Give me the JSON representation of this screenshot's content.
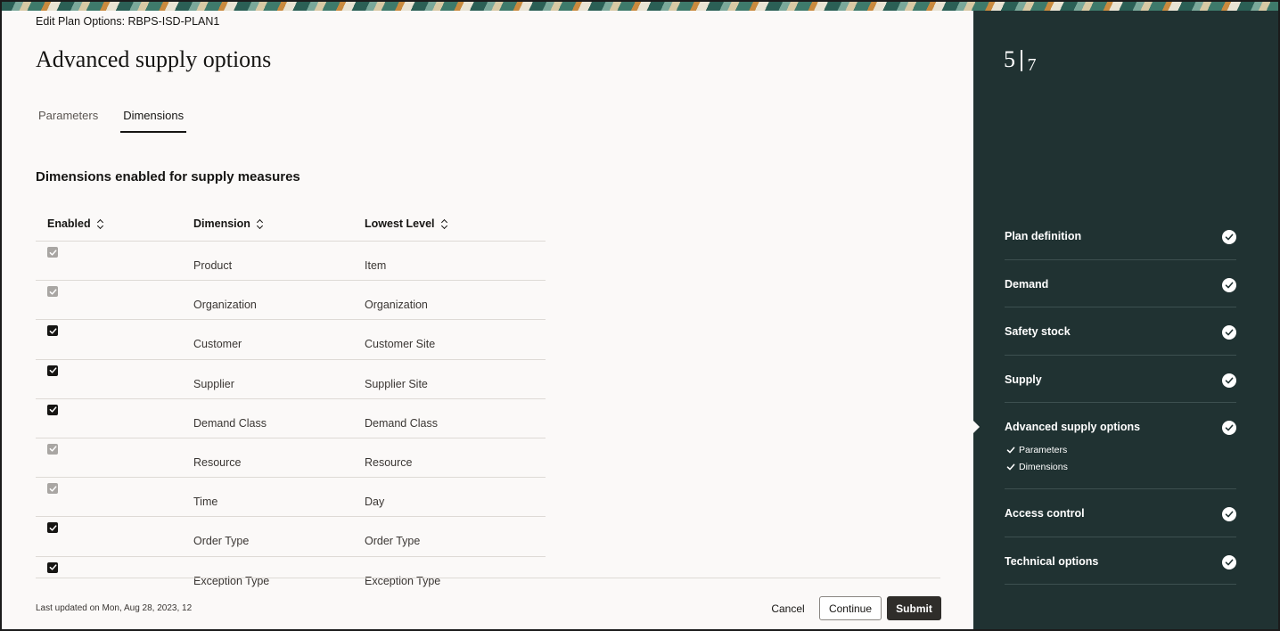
{
  "breadcrumb": "Edit Plan Options: RBPS-ISD-PLAN1",
  "page_title": "Advanced supply options",
  "tabs": [
    {
      "label": "Parameters",
      "active": false
    },
    {
      "label": "Dimensions",
      "active": true
    }
  ],
  "section_title": "Dimensions enabled for supply measures",
  "table": {
    "columns": [
      "Enabled",
      "Dimension",
      "Lowest Level"
    ],
    "rows": [
      {
        "enabled": "disabled",
        "dimension": "Product",
        "lowest_level": "Item"
      },
      {
        "enabled": "disabled",
        "dimension": "Organization",
        "lowest_level": "Organization"
      },
      {
        "enabled": "on",
        "dimension": "Customer",
        "lowest_level": "Customer Site"
      },
      {
        "enabled": "on",
        "dimension": "Supplier",
        "lowest_level": "Supplier Site"
      },
      {
        "enabled": "on",
        "dimension": "Demand Class",
        "lowest_level": "Demand Class"
      },
      {
        "enabled": "disabled",
        "dimension": "Resource",
        "lowest_level": "Resource"
      },
      {
        "enabled": "disabled",
        "dimension": "Time",
        "lowest_level": "Day"
      },
      {
        "enabled": "on",
        "dimension": "Order Type",
        "lowest_level": "Order Type"
      },
      {
        "enabled": "on",
        "dimension": "Exception Type",
        "lowest_level": "Exception Type"
      }
    ]
  },
  "footer": {
    "last_updated": "Last updated on Mon, Aug 28, 2023, 12",
    "cancel_label": "Cancel",
    "continue_label": "Continue",
    "submit_label": "Submit"
  },
  "side": {
    "step_current": "5",
    "step_total": "7",
    "nav": [
      {
        "label": "Plan definition",
        "complete": true
      },
      {
        "label": "Demand",
        "complete": true
      },
      {
        "label": "Safety stock",
        "complete": true
      },
      {
        "label": "Supply",
        "complete": true
      },
      {
        "label": "Advanced supply options",
        "complete": true,
        "current": true,
        "sub": [
          "Parameters",
          "Dimensions"
        ]
      },
      {
        "label": "Access control",
        "complete": true
      },
      {
        "label": "Technical options",
        "complete": true
      }
    ]
  },
  "colors": {
    "side_panel": "#203232",
    "submit_button": "#2f2d2a",
    "page_background": "#fbf9f8"
  }
}
